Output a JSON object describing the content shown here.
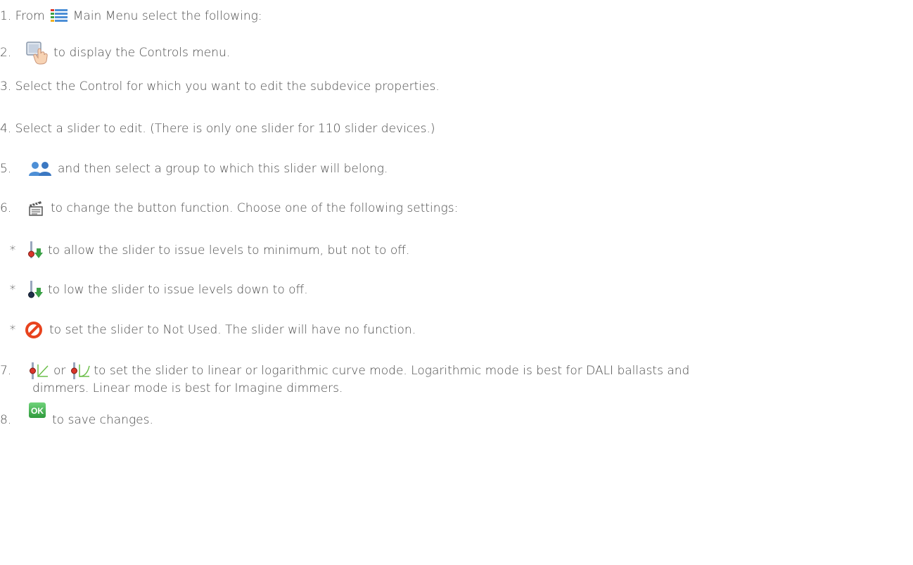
{
  "steps": [
    {
      "num": "1. From",
      "text": "Main Menu select the following:",
      "icon": "main-menu-icon"
    },
    {
      "num": "2.",
      "text": "to display the Controls menu.",
      "icon": "controls-touch-icon"
    },
    {
      "num": "",
      "text": "3. Select the Control for which you want to edit the subdevice properties."
    },
    {
      "num": "",
      "text": "4. Select a slider to edit. (There is only one slider for 110 slider devices.)"
    },
    {
      "num": "5.",
      "text": "and then select a group to which this slider will belong.",
      "icon": "groups-icon"
    },
    {
      "num": "6.",
      "text": "to change the button function. Choose one of the following settings:",
      "icon": "scene-clapper-icon"
    },
    {
      "num": "7.",
      "text_or": "or",
      "text": "to set the slider to linear or logarithmic curve mode. Logarithmic mode is best for DALI ballasts and",
      "text2": "dimmers. Linear mode is best for Imagine dimmers.",
      "icon": "linear-curve-icon",
      "icon2": "log-curve-icon"
    },
    {
      "num": "8.",
      "text": "to save changes.",
      "icon": "ok-icon",
      "icon_label": "OK"
    }
  ],
  "sub_items": [
    {
      "bullet": "*",
      "text": "to allow the slider to issue levels to minimum, but not to off.",
      "icon": "slider-min-icon"
    },
    {
      "bullet": "*",
      "text": "to low the slider to issue levels down to off.",
      "icon": "slider-off-icon"
    },
    {
      "bullet": "*",
      "text": "to set the slider to Not Used. The slider will have no function.",
      "icon": "not-used-icon"
    }
  ],
  "colors": {
    "text": "#4a4a4a",
    "ok_green": "#3cb04a",
    "not_used_red": "#e8431e",
    "group_blue": "#4d8fd6",
    "slider_red": "#d9352a",
    "slider_green": "#3aa046",
    "curve_green": "#6cbf4a"
  }
}
